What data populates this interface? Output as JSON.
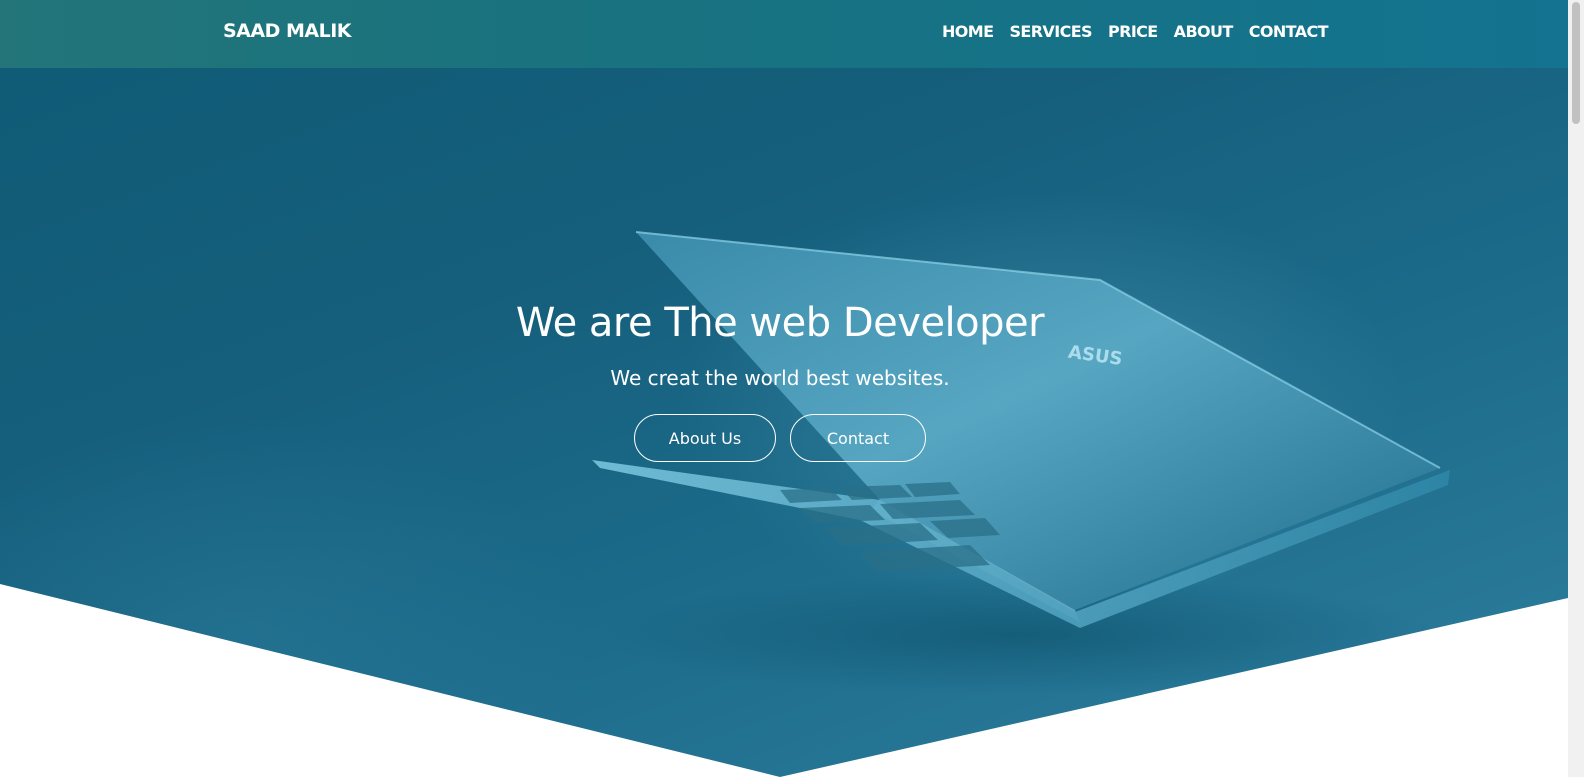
{
  "navbar": {
    "brand": "SAAD MALIK",
    "links": [
      "HOME",
      "SERVICES",
      "PRICE",
      "ABOUT",
      "CONTACT"
    ]
  },
  "hero": {
    "title": "We are The web Developer",
    "subtitle": "We creat the world best websites.",
    "buttons": {
      "about": "About Us",
      "contact": "Contact"
    }
  },
  "colors": {
    "navbar": "#18727f",
    "hero": "#155f7c",
    "text": "#ffffff"
  },
  "icons": {
    "hero_image": "laptop-icon"
  }
}
